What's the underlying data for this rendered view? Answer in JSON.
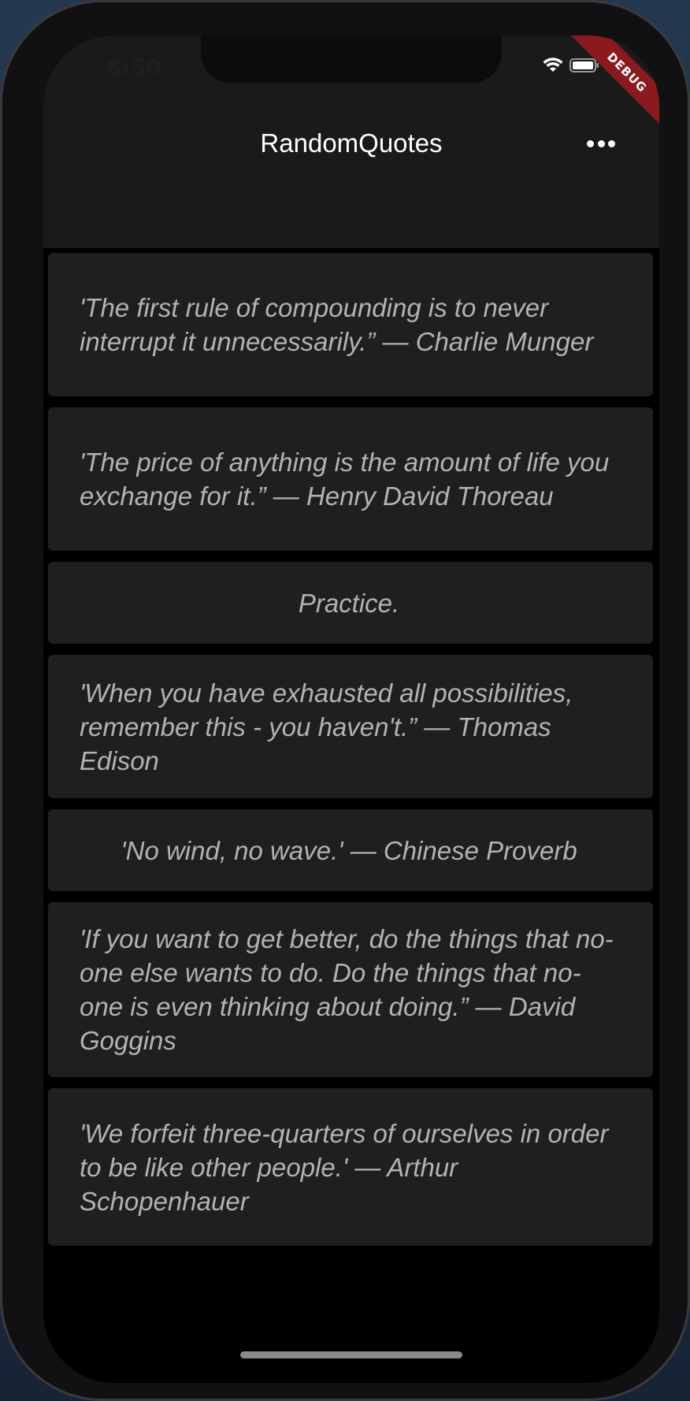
{
  "status_bar": {
    "time": "8:50",
    "debug_label": "DEBUG"
  },
  "app_bar": {
    "title": "RandomQuotes",
    "menu_icon": "more-horizontal-icon"
  },
  "quotes": [
    {
      "text": "'The first rule of compounding is to never interrupt it unnecessarily.” — Charlie Munger"
    },
    {
      "text": "'The price of anything is the amount of life you exchange for it.” — Henry David Thoreau"
    },
    {
      "text": "Practice."
    },
    {
      "text": "'When you have exhausted all possibilities, remember this - you haven't.” — Thomas Edison"
    },
    {
      "text": "'No wind, no wave.' — Chinese Proverb"
    },
    {
      "text": "'If you want to get better, do the things that no-one else wants to do. Do the things that no-one is even thinking about doing.” — David Goggins"
    },
    {
      "text": "'We forfeit three-quarters of ourselves in order to be like other people.' — Arthur Schopenhauer"
    }
  ],
  "colors": {
    "app_bar": "#1a1a1d",
    "card": "#1f1f21",
    "quote_text": "#b3b3b6",
    "background": "#000000",
    "debug_banner": "#8a1a1e"
  }
}
